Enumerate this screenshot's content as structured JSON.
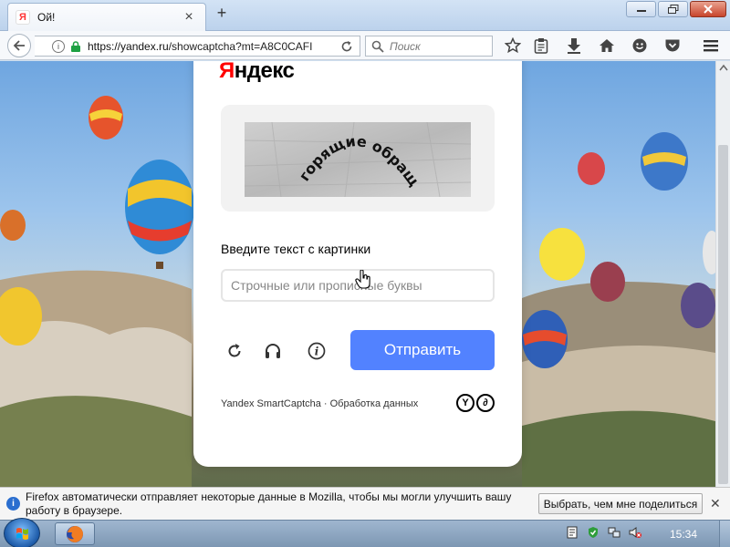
{
  "browser": {
    "tab_title": "Ой!",
    "tab_favicon": "Я",
    "url_host": "https://yandex.ru",
    "url_path": "/showcaptcha?mt=A8C0CAFI",
    "search_placeholder": "Поиск"
  },
  "captcha": {
    "logo_first": "Я",
    "logo_rest": "ндекс",
    "image_text": "горящие обращалась",
    "prompt": "Введите текст с картинки",
    "input_placeholder": "Строчные или прописные буквы",
    "input_value": "",
    "submit_label": "Отправить",
    "footer_text": "Yandex SmartCaptcha · Обработка данных",
    "badge_1": "Y",
    "badge_2": "∂",
    "colors": {
      "accent": "#5282ff",
      "logo_red": "#ff0000"
    }
  },
  "notification": {
    "text": "Firefox автоматически отправляет некоторые данные в Mozilla, чтобы мы могли улучшить вашу работу в браузере.",
    "button_label": "Выбрать, чем мне поделиться"
  },
  "taskbar": {
    "clock": "15:34"
  }
}
